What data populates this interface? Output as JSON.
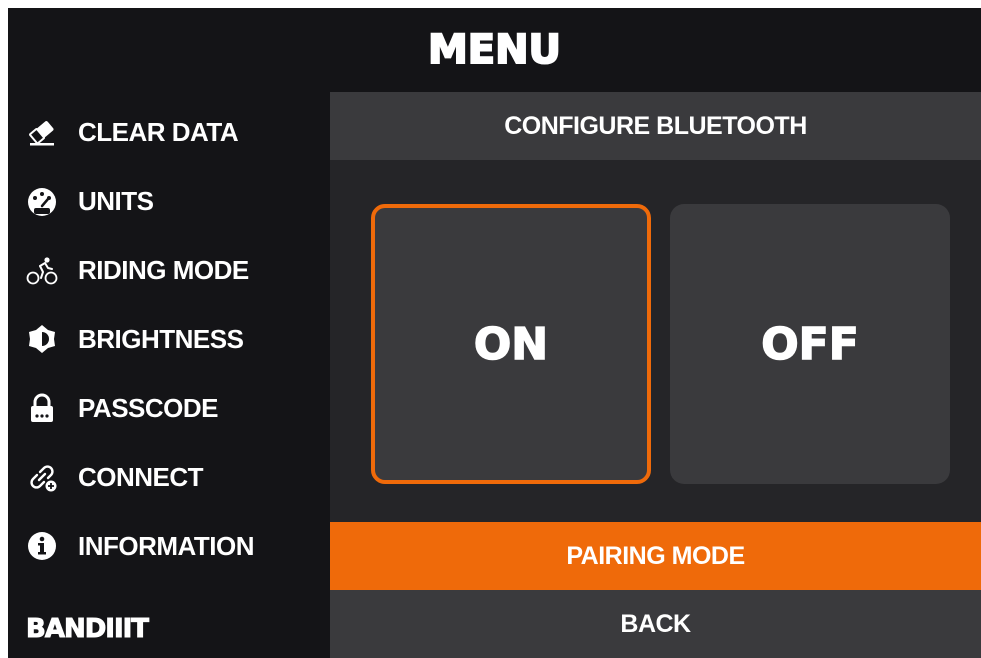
{
  "header": {
    "title": "MENU"
  },
  "sidebar": {
    "items": [
      {
        "label": "CLEAR DATA",
        "icon": "eraser-icon"
      },
      {
        "label": "UNITS",
        "icon": "speedometer-icon"
      },
      {
        "label": "RIDING MODE",
        "icon": "cyclist-icon"
      },
      {
        "label": "BRIGHTNESS",
        "icon": "brightness-icon"
      },
      {
        "label": "PASSCODE",
        "icon": "lock-icon"
      },
      {
        "label": "CONNECT",
        "icon": "link-plus-icon"
      },
      {
        "label": "INFORMATION",
        "icon": "info-icon"
      }
    ],
    "brand": "BANDIIIT"
  },
  "panel": {
    "title": "CONFIGURE BLUETOOTH",
    "options": {
      "on": "ON",
      "off": "OFF",
      "selected": "on"
    },
    "pairing_label": "PAIRING MODE",
    "back_label": "BACK"
  },
  "colors": {
    "background": "#141417",
    "panel": "#252528",
    "surface": "#3a3a3d",
    "accent": "#ef6a0a",
    "text": "#ffffff"
  }
}
